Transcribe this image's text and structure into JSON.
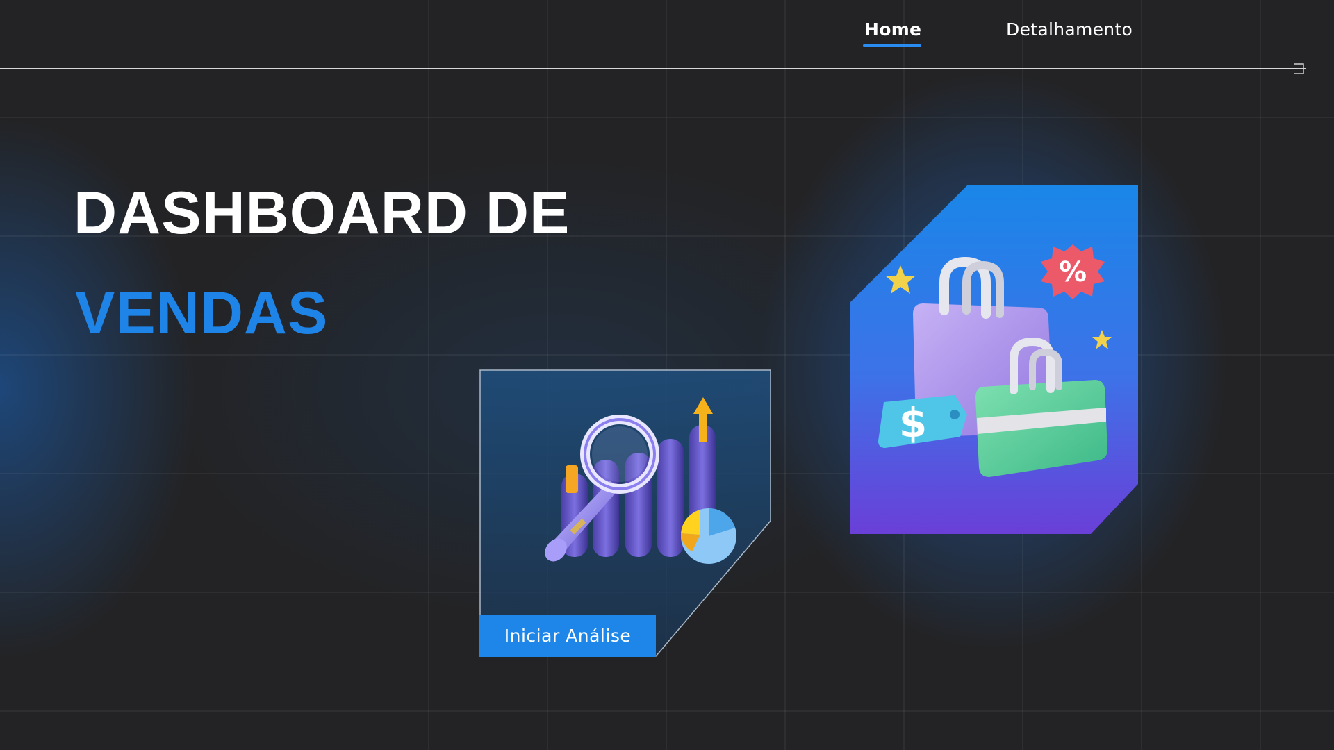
{
  "nav": {
    "tabs": [
      {
        "label": "Home",
        "active": true
      },
      {
        "label": "Detalhamento",
        "active": false
      }
    ]
  },
  "hero": {
    "title_line1": "DASHBOARD DE",
    "title_line2": "VENDAS"
  },
  "card": {
    "button_label": "Iniciar Análise",
    "illustration_icon": "analytics-magnifier-chart-icon"
  },
  "hero_image": {
    "icon": "shopping-bags-icon",
    "badge_text": "%",
    "tag_text": "$"
  },
  "colors": {
    "background": "#232325",
    "accent": "#1e84e8",
    "title_text": "#ffffff"
  }
}
